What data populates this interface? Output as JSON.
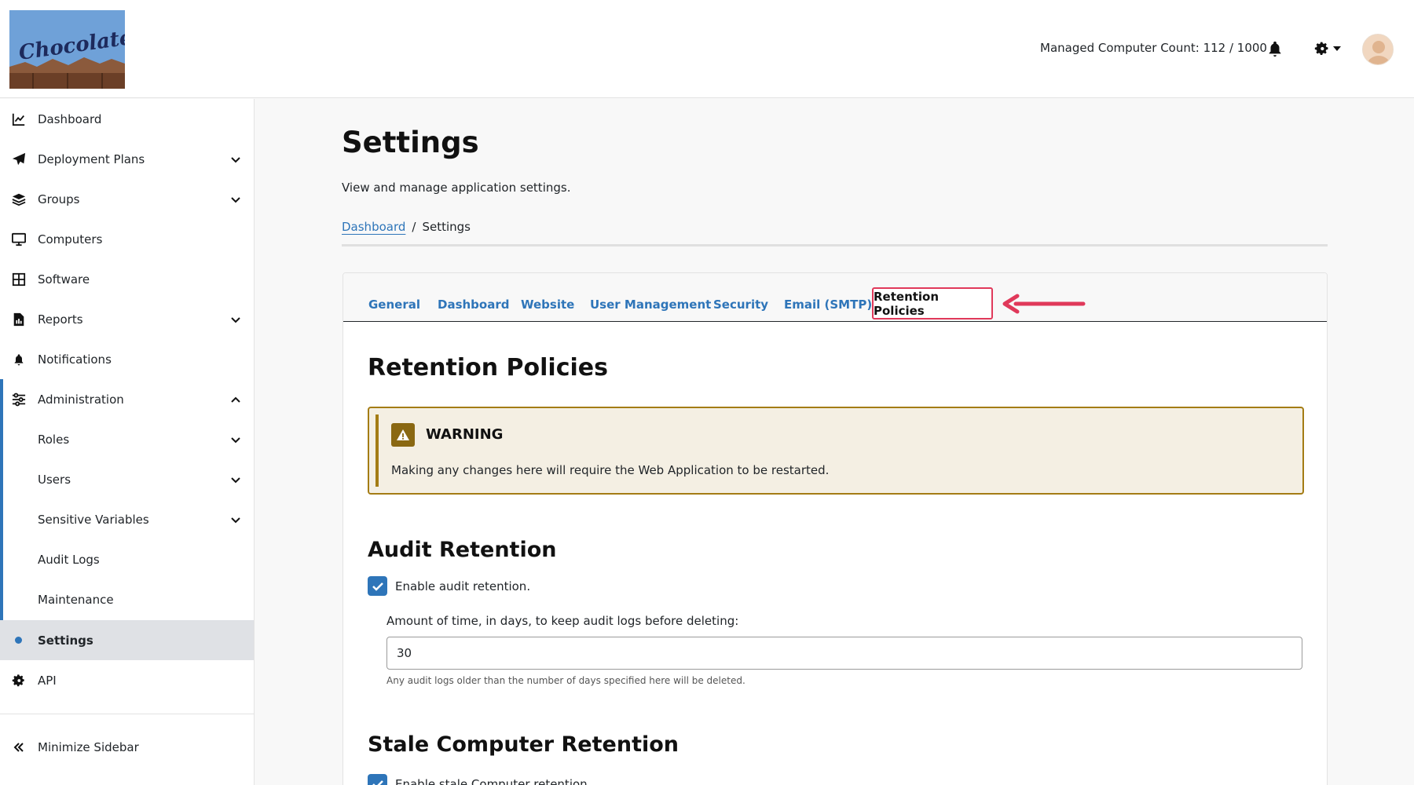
{
  "header": {
    "logo_text": "Chocolatey",
    "managed_count": "Managed Computer Count: 112 / 1000"
  },
  "sidebar": {
    "items": [
      {
        "label": "Dashboard"
      },
      {
        "label": "Deployment Plans"
      },
      {
        "label": "Groups"
      },
      {
        "label": "Computers"
      },
      {
        "label": "Software"
      },
      {
        "label": "Reports"
      },
      {
        "label": "Notifications"
      },
      {
        "label": "Administration"
      },
      {
        "label": "Roles"
      },
      {
        "label": "Users"
      },
      {
        "label": "Sensitive Variables"
      },
      {
        "label": "Audit Logs"
      },
      {
        "label": "Maintenance"
      },
      {
        "label": "Settings"
      },
      {
        "label": "API"
      }
    ],
    "minimize_label": "Minimize Sidebar"
  },
  "page": {
    "title": "Settings",
    "subtitle": "View and manage application settings.",
    "breadcrumb": {
      "link": "Dashboard",
      "separator": "/",
      "current": "Settings"
    }
  },
  "tabs": [
    "General",
    "Dashboard",
    "Website",
    "User Management",
    "Security",
    "Email (SMTP)",
    "Retention Policies"
  ],
  "content": {
    "title": "Retention Policies",
    "warning": {
      "title": "WARNING",
      "text": "Making any changes here will require the Web Application to be restarted."
    },
    "audit": {
      "title": "Audit Retention",
      "checkbox_label": "Enable audit retention.",
      "field_label": "Amount of time, in days, to keep audit logs before deleting:",
      "field_value": "30",
      "help": "Any audit logs older than the number of days specified here will be deleted."
    },
    "stale": {
      "title": "Stale Computer Retention",
      "checkbox_label": "Enable stale Computer retention."
    }
  },
  "colors": {
    "accent": "#2e75b9",
    "highlight": "#e0395a",
    "warning_border": "#a47c14",
    "warning_bg": "#f4efe3"
  }
}
